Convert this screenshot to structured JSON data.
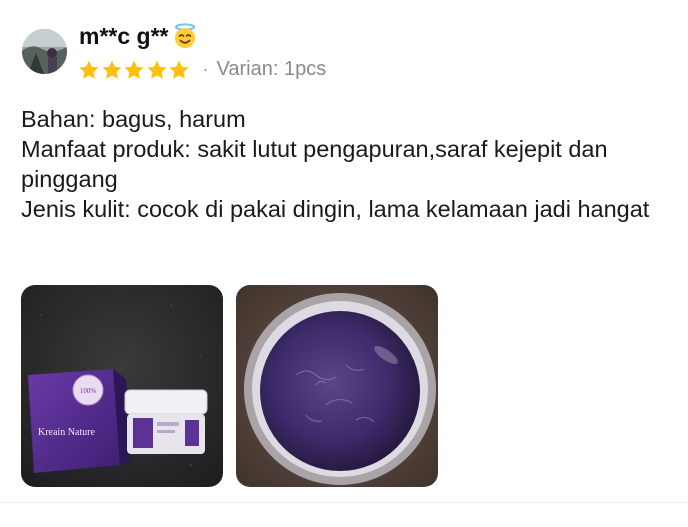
{
  "review": {
    "username": "m**c g**",
    "username_emoji": "smiling-face-with-halo-icon",
    "rating": 5,
    "rating_max": 5,
    "separator": "·",
    "variant_label": "Varian: 1pcs",
    "text_lines": [
      "Bahan: bagus, harum",
      "Manfaat produk: sakit lutut pengapuran,saraf kejepit dan pinggang",
      "Jenis kulit: cocok di pakai dingin, lama kelamaan jadi hangat"
    ],
    "photos": [
      {
        "icon": "product-box-and-jar-photo",
        "box_brand": "Kreain Nature",
        "box_badge": "100%"
      },
      {
        "icon": "open-jar-purple-gel-photo"
      }
    ]
  },
  "colors": {
    "star": "#ffc107",
    "variant_text": "#8a8a8a",
    "box_purple": "#5b2f96",
    "gel_purple": "#3d2b6b"
  }
}
